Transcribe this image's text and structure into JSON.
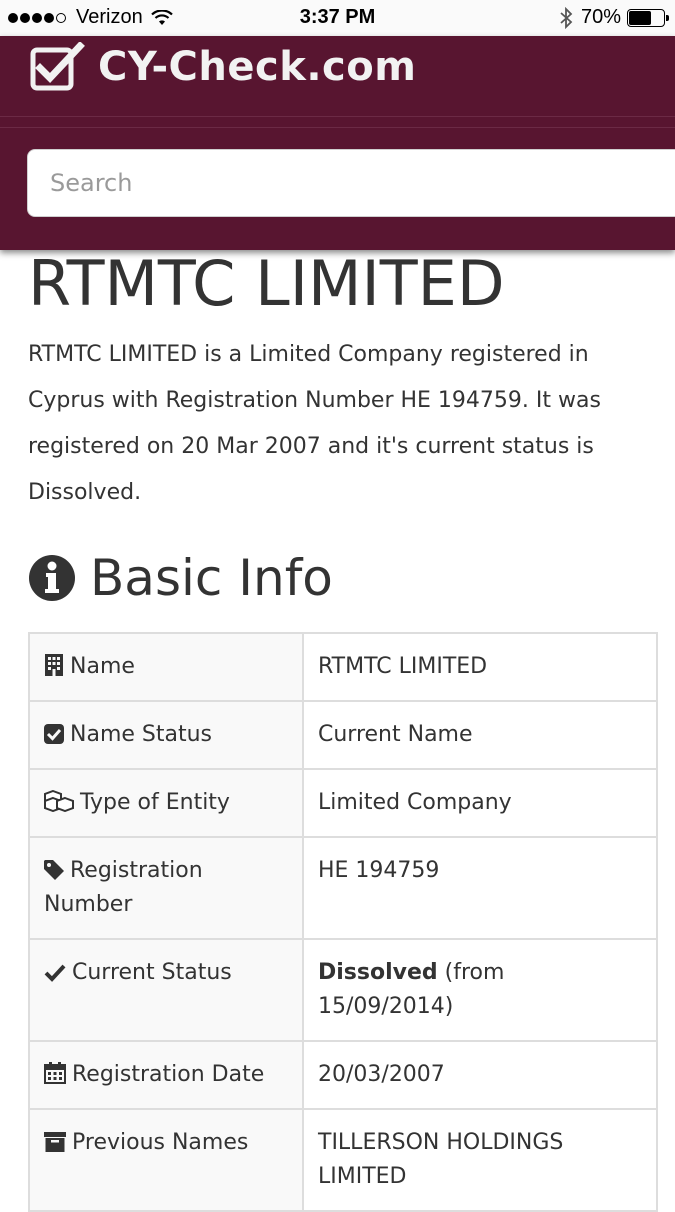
{
  "status_bar": {
    "carrier": "Verizon",
    "time": "3:37 PM",
    "battery": "70%",
    "battery_level": 0.7
  },
  "header": {
    "logo_text": "CY-Check.com",
    "search_placeholder": "Search"
  },
  "company": {
    "title": "RTMTC LIMITED",
    "description": "RTMTC LIMITED is a Limited Company registered in Cyprus with Registration Number HE 194759. It was registered on 20 Mar 2007 and it's current status is Dissolved."
  },
  "basic_info": {
    "heading": "Basic Info",
    "rows": [
      {
        "icon": "building-icon",
        "label": "Name",
        "value": "RTMTC LIMITED"
      },
      {
        "icon": "check-square-icon",
        "label": "Name Status",
        "value": "Current Name"
      },
      {
        "icon": "cubes-icon",
        "label": "Type of Entity",
        "value": "Limited Company"
      },
      {
        "icon": "tag-icon",
        "label": "Registration Number",
        "value": "HE 194759"
      },
      {
        "icon": "check-icon",
        "label": "Current Status",
        "value_bold": "Dissolved",
        "value": " (from 15/09/2014)"
      },
      {
        "icon": "calendar-icon",
        "label": "Registration Date",
        "value": "20/03/2007"
      },
      {
        "icon": "archive-icon",
        "label": "Previous Names",
        "value": "TILLERSON HOLDINGS LIMITED"
      }
    ]
  }
}
